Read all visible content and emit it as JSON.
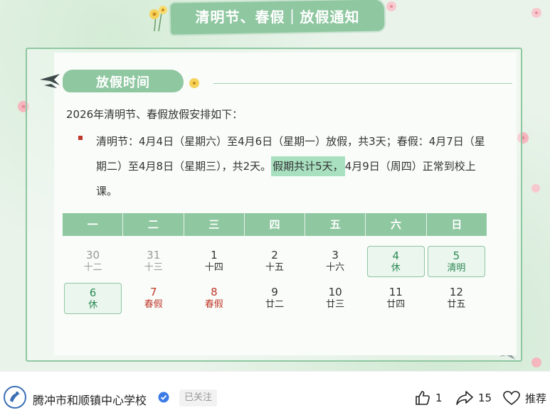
{
  "poster": {
    "title": "清明节、春假｜放假通知",
    "section_title": "放假时间",
    "intro": "2026年清明节、春假放假安排如下：",
    "para_part1": "清明节：4月4日（星期六）至4月6日（星期一）放假，共3天；春假：4月7日（星期二）至4月8日（星期三），共2天。",
    "para_highlight": "假期共计5天，",
    "para_part2": "4月9日（周四）正常到校上课。"
  },
  "calendar": {
    "weekdays": [
      "一",
      "二",
      "三",
      "四",
      "五",
      "六",
      "日"
    ],
    "days": [
      {
        "num": "30",
        "lunar": "十二",
        "style": "muted"
      },
      {
        "num": "31",
        "lunar": "十三",
        "style": "muted"
      },
      {
        "num": "1",
        "lunar": "十四",
        "style": "normal"
      },
      {
        "num": "2",
        "lunar": "十五",
        "style": "normal"
      },
      {
        "num": "3",
        "lunar": "十六",
        "style": "normal"
      },
      {
        "num": "4",
        "lunar": "休",
        "style": "hol"
      },
      {
        "num": "5",
        "lunar": "清明",
        "style": "hol"
      },
      {
        "num": "6",
        "lunar": "休",
        "style": "hol"
      },
      {
        "num": "7",
        "lunar": "春假",
        "style": "red"
      },
      {
        "num": "8",
        "lunar": "春假",
        "style": "red"
      },
      {
        "num": "9",
        "lunar": "廿二",
        "style": "normal"
      },
      {
        "num": "10",
        "lunar": "廿三",
        "style": "normal"
      },
      {
        "num": "11",
        "lunar": "廿四",
        "style": "normal"
      },
      {
        "num": "12",
        "lunar": "廿五",
        "style": "normal"
      }
    ]
  },
  "footer": {
    "school_name": "腾冲市和顺镇中心学校",
    "follow_label": "已关注",
    "like_count": "1",
    "share_count": "15",
    "recommend_label": "推荐"
  },
  "colors": {
    "accent": "#8fc7a1",
    "holiday_text": "#2f8a56",
    "red": "#c0392b"
  }
}
